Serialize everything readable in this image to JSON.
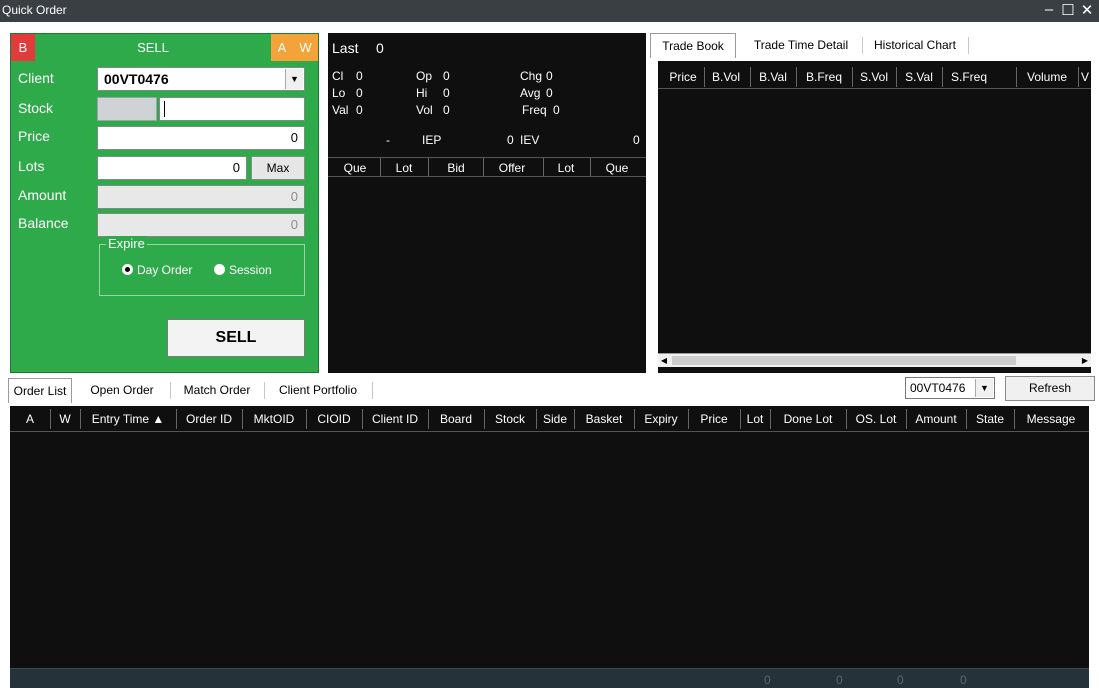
{
  "window": {
    "title": "Quick Order",
    "minimize": "–",
    "maximize": "☐",
    "close": "✕"
  },
  "order_form": {
    "side_buy_label": "B",
    "side_title": "SELL",
    "flag_a": "A",
    "flag_w": "W",
    "client_label": "Client",
    "client_value": "00VT0476",
    "stock_label": "Stock",
    "stock_code": "",
    "stock_name": "",
    "price_label": "Price",
    "price_value": "0",
    "lots_label": "Lots",
    "lots_value": "0",
    "max_label": "Max",
    "amount_label": "Amount",
    "amount_value": "0",
    "balance_label": "Balance",
    "balance_value": "0",
    "expire_label": "Expire",
    "expire_options": [
      "Day Order",
      "Session"
    ],
    "expire_selected": "Day Order",
    "submit_label": "SELL",
    "colors": {
      "panel": "#2eaa4a",
      "buy": "#e23b3b",
      "flag": "#f2a33a"
    }
  },
  "market": {
    "last_label": "Last",
    "last_value": "0",
    "cl_label": "Cl",
    "cl_value": "0",
    "op_label": "Op",
    "op_value": "0",
    "chg_label": "Chg",
    "chg_value": "0",
    "lo_label": "Lo",
    "lo_value": "0",
    "hi_label": "Hi",
    "hi_value": "0",
    "avg_label": "Avg",
    "avg_value": "0",
    "val_label": "Val",
    "val_value": "0",
    "vol_label": "Vol",
    "vol_value": "0",
    "freq_label": "Freq",
    "freq_value": "0",
    "dash": "-",
    "iep_label": "IEP",
    "iep_value": "0",
    "iev_label": "IEV",
    "iev_value": "0",
    "queue_columns": [
      "Que",
      "Lot",
      "Bid",
      "Offer",
      "Lot",
      "Que"
    ]
  },
  "trade_book": {
    "tabs": [
      "Trade Book",
      "Trade Time Detail",
      "Historical Chart"
    ],
    "active_tab": "Trade Book",
    "columns": [
      "Price",
      "B.Vol",
      "B.Val",
      "B.Freq",
      "S.Vol",
      "S.Val",
      "S.Freq",
      "Volume",
      "V"
    ]
  },
  "order_list": {
    "tabs": [
      "Order List",
      "Open Order",
      "Match Order",
      "Client Portfolio"
    ],
    "active_tab": "Order List",
    "client_filter": "00VT0476",
    "refresh_label": "Refresh",
    "columns": [
      "A",
      "W",
      "Entry Time ▲",
      "Order ID",
      "MktOID",
      "CIOID",
      "Client ID",
      "Board",
      "Stock",
      "Side",
      "Basket",
      "Expiry",
      "Price",
      "Lot",
      "Done Lot",
      "OS. Lot",
      "Amount",
      "State",
      "Message"
    ],
    "footer_totals": [
      "0",
      "0",
      "0",
      "0"
    ]
  }
}
